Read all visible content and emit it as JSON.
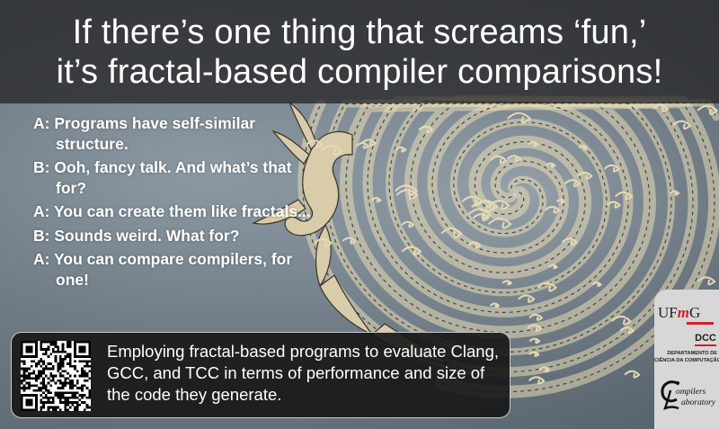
{
  "title": {
    "line1": "If there’s one thing that screams ‘fun,’",
    "line2": "it’s fractal-based compiler comparisons!"
  },
  "dialogue": [
    "A: Programs have self-similar structure.",
    "B: Ooh, fancy talk. And what’s that for?",
    "A: You can create them like fractals...",
    "B: Sounds weird. What for?",
    "A: You can compare compilers, for one!"
  ],
  "info": {
    "text": "Employing fractal-based programs to evaluate Clang, GCC, and TCC in terms of performance and size of the code they generate."
  },
  "logos": {
    "ufmg_u": "UF",
    "ufmg_m": "m",
    "ufmg_g": "G",
    "dcc": "DCC",
    "dept_line1": "DEPARTAMENTO DE",
    "dept_line2": "CIÊNCIA DA COMPUTAÇÃO",
    "lab_line1": "ompilers",
    "lab_line2": "aboratory"
  },
  "colors": {
    "accent_red": "#d1202b",
    "fractal_cream": "#e8dcb8",
    "band_dark": "#282828"
  }
}
